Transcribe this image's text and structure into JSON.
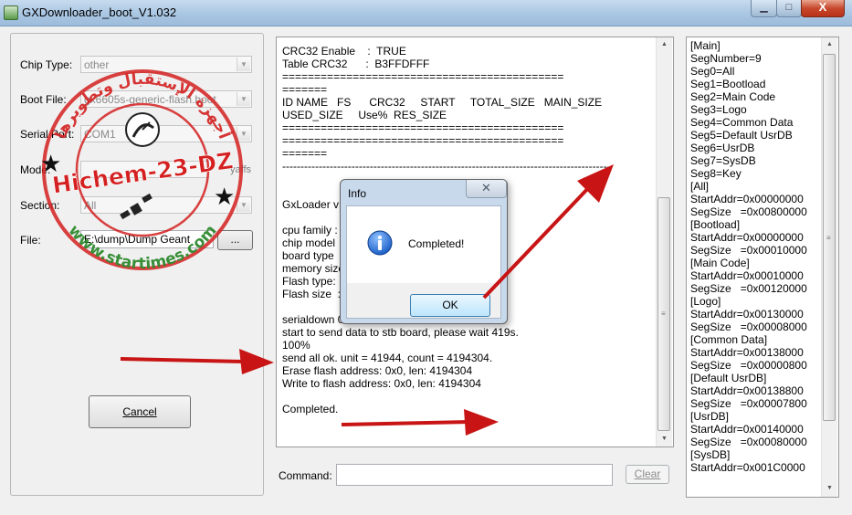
{
  "window": {
    "title": "GXDownloader_boot_V1.032",
    "min_icon": "minimize-icon",
    "max_icon": "maximize-icon",
    "close_icon": "close-icon",
    "close_glyph": "X"
  },
  "left": {
    "chip_type_label": "Chip Type:",
    "chip_type_value": "other",
    "boot_file_label": "Boot File:",
    "boot_file_value": "gx6605s-generic-flash.boot",
    "serial_port_label": "Serial Port:",
    "serial_port_value": "COM1",
    "mode_label": "Mode:",
    "yaffs_label": "yaffs",
    "section_label": "Section:",
    "section_value": "All",
    "file_label": "File:",
    "file_value": "E:\\dump\\Dump Geant",
    "browse_label": "...",
    "cancel_label": "Cancel"
  },
  "watermark": {
    "top_text": "أجهزة الإستقبال وتطويرها",
    "name": "Hichem-23-DZ",
    "site": "www.startimes.com"
  },
  "log": {
    "lines": [
      "CRC32 Enable    :  TRUE",
      "Table CRC32      :  B3FFDFFF",
      "============================================",
      "=======",
      "ID NAME   FS      CRC32     START     TOTAL_SIZE   MAIN_SIZE",
      "USED_SIZE     Use%  RES_SIZE",
      "============================================",
      "============================================",
      "=======",
      "------------------------------------------------------------------------------------------",
      "",
      "",
      "GxLoader v1",
      "",
      "cpu family :",
      "chip model",
      "board type",
      "memory size",
      "Flash type:",
      "Flash size  :",
      "",
      "serialdown 0x",
      "start to send data to stb board, please wait 419s.",
      "100%",
      "send all ok. unit = 41944, count = 4194304.",
      "Erase flash address: 0x0, len: 4194304",
      "Write to flash address: 0x0, len: 4194304",
      "",
      "Completed."
    ],
    "command_label": "Command:",
    "command_value": "",
    "clear_label": "Clear"
  },
  "seglog": {
    "lines": [
      "[Main]",
      "SegNumber=9",
      "Seg0=All",
      "Seg1=Bootload",
      "Seg2=Main Code",
      "Seg3=Logo",
      "Seg4=Common Data",
      "Seg5=Default UsrDB",
      "Seg6=UsrDB",
      "Seg7=SysDB",
      "Seg8=Key",
      "[All]",
      "StartAddr=0x00000000",
      "SegSize   =0x00800000",
      "[Bootload]",
      "StartAddr=0x00000000",
      "SegSize   =0x00010000",
      "[Main Code]",
      "StartAddr=0x00010000",
      "SegSize   =0x00120000",
      "[Logo]",
      "StartAddr=0x00130000",
      "SegSize   =0x00008000",
      "[Common Data]",
      "StartAddr=0x00138000",
      "SegSize   =0x00000800",
      "[Default UsrDB]",
      "StartAddr=0x00138800",
      "SegSize   =0x00007800",
      "[UsrDB]",
      "StartAddr=0x00140000",
      "SegSize   =0x00080000",
      "[SysDB]",
      "StartAddr=0x001C0000"
    ]
  },
  "dialog": {
    "title": "Info",
    "close_glyph": "✕",
    "message": "Completed!",
    "ok_label": "OK",
    "icon": "info-icon"
  },
  "colors": {
    "stamp_red": "#d42020",
    "stamp_green": "#2f8a2f",
    "arrow_red": "#c81414",
    "info_blue": "#1b5fc7"
  }
}
